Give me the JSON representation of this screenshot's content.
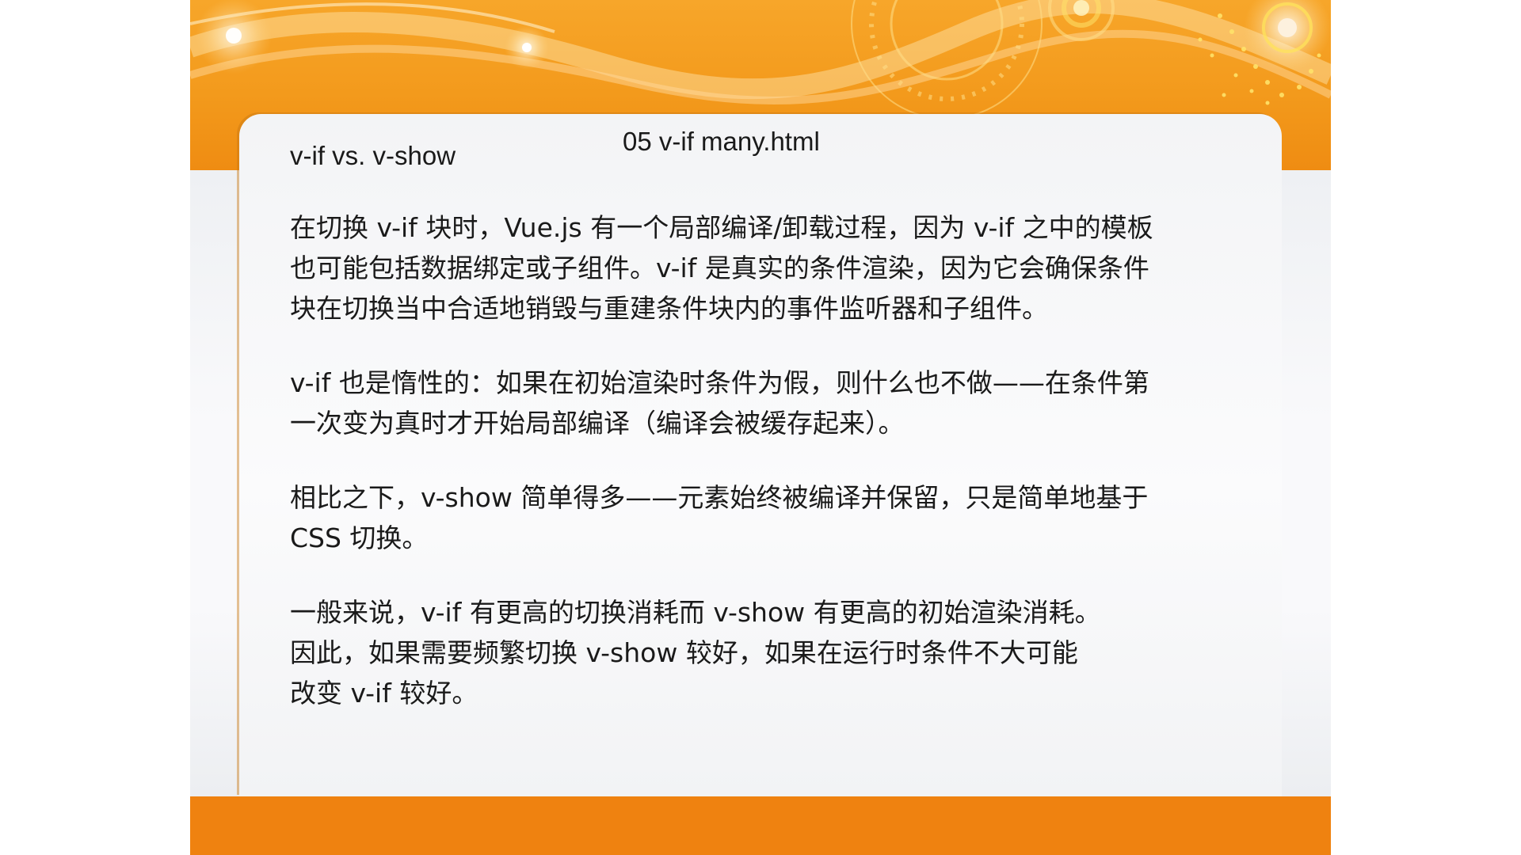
{
  "slide": {
    "file_label": "05 v-if many.html",
    "title": "v-if vs. v-show",
    "paragraphs": [
      {
        "lines": [
          "在切换 v-if 块时，Vue.js 有一个局部编译/卸载过程，因为 v-if 之中的模板",
          "也可能包括数据绑定或子组件。v-if 是真实的条件渲染，因为它会确保条件",
          "块在切换当中合适地销毁与重建条件块内的事件监听器和子组件。"
        ]
      },
      {
        "lines": [
          "v-if 也是惰性的：如果在初始渲染时条件为假，则什么也不做——在条件第",
          "一次变为真时才开始局部编译（编译会被缓存起来）。"
        ]
      },
      {
        "lines": [
          "相比之下，v-show 简单得多——元素始终被编译并保留，只是简单地基于",
          "CSS 切换。"
        ]
      },
      {
        "lines": [
          "一般来说，v-if 有更高的切换消耗而 v-show 有更高的初始渲染消耗。",
          "因此，如果需要频繁切换 v-show 较好，如果在运行时条件不大可能",
          "改变 v-if 较好。"
        ]
      }
    ]
  },
  "colors": {
    "accent_orange": "#ef8a10",
    "panel": "#f7f8fa",
    "text": "#1a1a1a"
  }
}
